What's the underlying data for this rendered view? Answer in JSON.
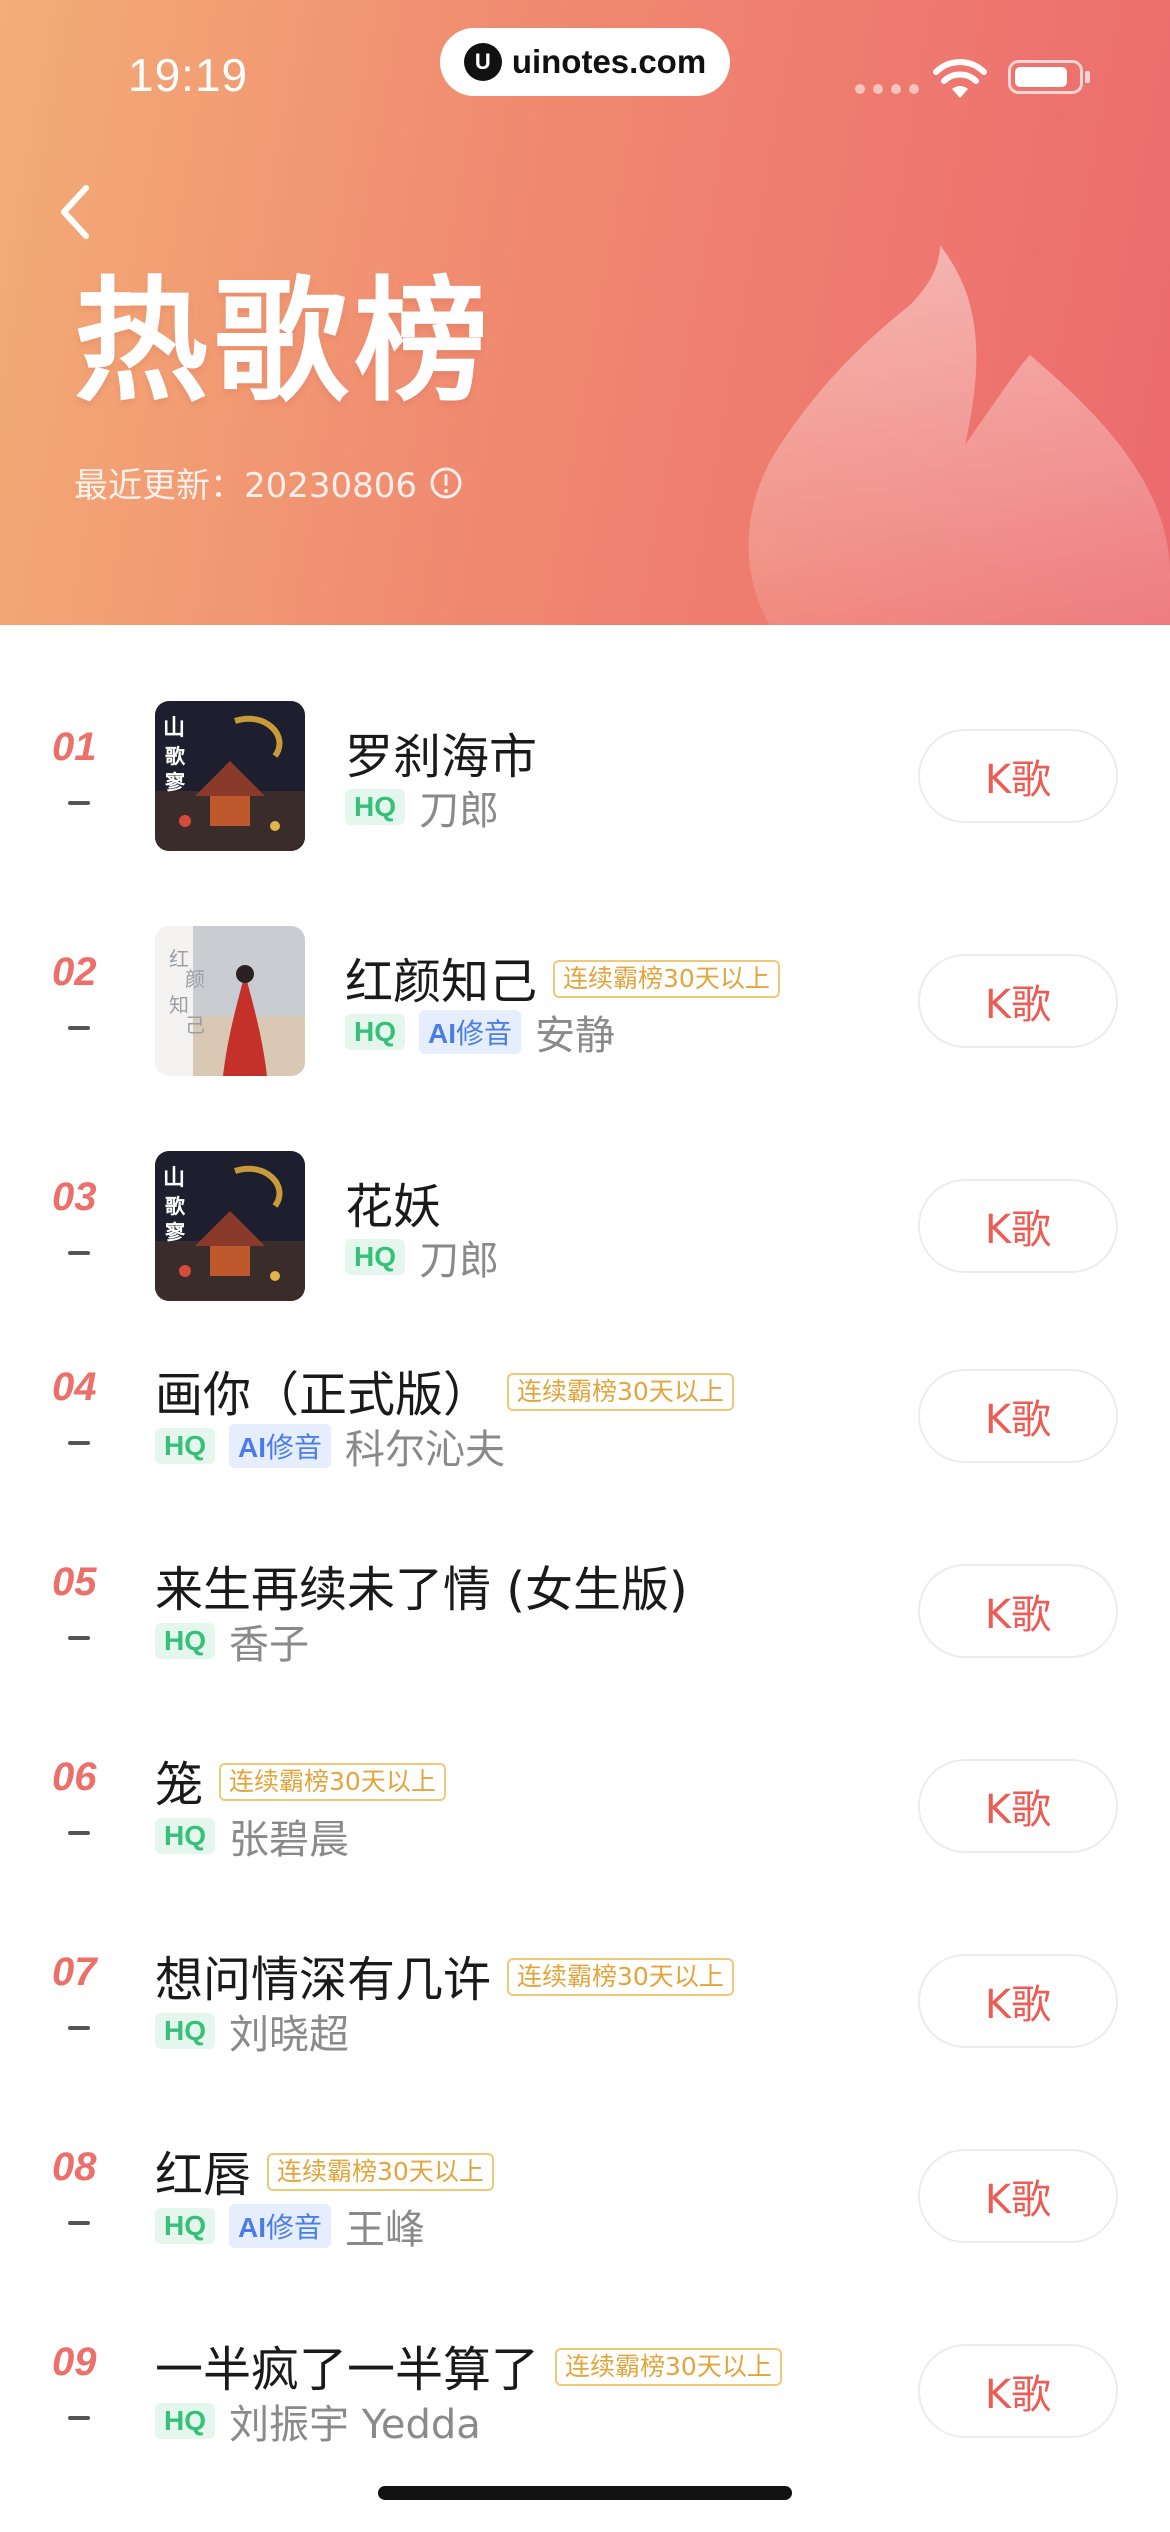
{
  "status_bar": {
    "time": "19:19",
    "url": "uinotes.com",
    "url_logo": "U"
  },
  "header": {
    "title": "热歌榜",
    "update_label": "最近更新：20230806",
    "colors": {
      "gradient_start": "#f3ad76",
      "gradient_end": "#ec6a6e"
    }
  },
  "list": {
    "button_label": "K歌",
    "hq_label": "HQ",
    "ai_label_a": "AI",
    "ai_label_b": "修音",
    "flag_label": "连续霸榜30天以上",
    "items": [
      {
        "rank": "01",
        "title": "罗刹海市",
        "artist": "刀郎",
        "cover": "album-art"
      },
      {
        "rank": "02",
        "title": "红颜知己",
        "artist": "安静",
        "cover": "album-art"
      },
      {
        "rank": "03",
        "title": "花妖",
        "artist": "刀郎",
        "cover": "album-art"
      },
      {
        "rank": "04",
        "title": "画你（正式版）",
        "artist": "科尔沁夫"
      },
      {
        "rank": "05",
        "title": "来生再续未了情 (女生版)",
        "artist": "香子"
      },
      {
        "rank": "06",
        "title": "笼",
        "artist": "张碧晨"
      },
      {
        "rank": "07",
        "title": "想问情深有几许",
        "artist": "刘晓超"
      },
      {
        "rank": "08",
        "title": "红唇",
        "artist": "王峰"
      },
      {
        "rank": "09",
        "title": "一半疯了一半算了",
        "artist": "刘振宇 Yedda"
      }
    ]
  },
  "cover_texts": {
    "cover_2_a": "红",
    "cover_2_b": "颜",
    "cover_2_c": "知",
    "cover_2_d": "己"
  }
}
